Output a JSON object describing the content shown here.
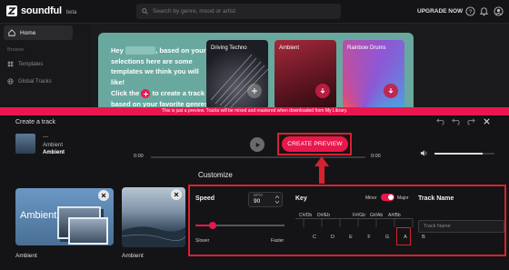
{
  "topbar": {
    "logo": "soundful",
    "beta": "beta",
    "search_placeholder": "Search by genre, mood or artist",
    "upgrade": "UPGRADE NOW"
  },
  "sidebar": {
    "home": "Home",
    "section": "Browse",
    "items": [
      {
        "label": "Templates",
        "icon": "grid-icon"
      },
      {
        "label": "Global Tracks",
        "icon": "globe-icon"
      }
    ]
  },
  "promo": {
    "hey": "Hey",
    "line1": ", based on your selections here are some templates we think you will like!",
    "click": "Click the",
    "line2": "to create a track based on your favorite genres",
    "cards": [
      {
        "label": "Driving Techno"
      },
      {
        "label": "Ambient"
      },
      {
        "label": "Rainbow Drums"
      }
    ]
  },
  "banner": "This is just a preview. Tracks will be mixed and mastered when downloaded from My Library.",
  "modal": {
    "title": "Create a track",
    "track_dash": "---",
    "track_genre": "Ambient",
    "track_name": "Ambient",
    "create_preview": "CREATE PREVIEW",
    "time_start": "0:00",
    "time_end": "0:00",
    "volume_level": 0.8,
    "customize": "Customize",
    "genres": [
      {
        "label": "Ambient",
        "card_text": "Ambient"
      },
      {
        "label": "Ambient",
        "card_text": ""
      }
    ],
    "speed": {
      "label": "Speed",
      "bpm_label": "BPM",
      "bpm": "90",
      "level": 0.19,
      "slower": "Slower",
      "faster": "Faster"
    },
    "key": {
      "label": "Key",
      "minor": "Minor",
      "major": "Major",
      "sharps": [
        "C#/Db",
        "D#/Eb",
        "F#/Gb",
        "G#/Ab",
        "A#/Bb"
      ],
      "naturals": [
        "C",
        "D",
        "E",
        "F",
        "G",
        "A",
        "B"
      ],
      "selected": "A"
    },
    "trackname": {
      "label": "Track Name",
      "placeholder": "Track Name"
    }
  },
  "colors": {
    "accent": "#e8184d",
    "highlight": "#d6222f",
    "promo_bg": "#68a89f"
  }
}
